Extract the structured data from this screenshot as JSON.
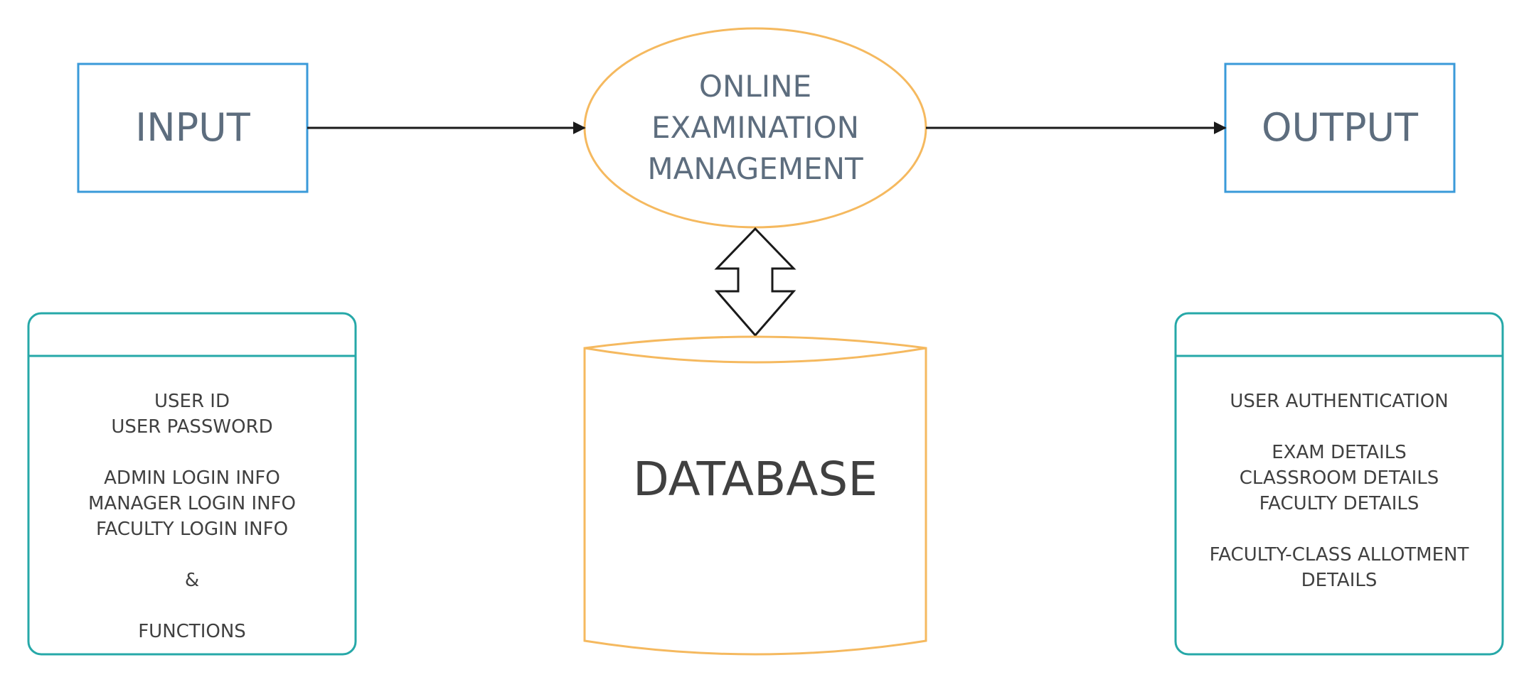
{
  "input_label": "INPUT",
  "output_label": "OUTPUT",
  "process_lines": [
    "ONLINE",
    "EXAMINATION",
    "MANAGEMENT"
  ],
  "database_label": "DATABASE",
  "input_details": {
    "user_id": "USER ID",
    "user_password": "USER PASSWORD",
    "admin_login": "ADMIN LOGIN INFO",
    "manager_login": "MANAGER LOGIN INFO",
    "faculty_login": "FACULTY LOGIN INFO",
    "ampersand": "&",
    "functions": "FUNCTIONS"
  },
  "output_details": {
    "user_auth": "USER AUTHENTICATION",
    "exam_details": "EXAM DETAILS",
    "classroom_details": "CLASSROOM DETAILS",
    "faculty_details": "FACULTY DETAILS",
    "allotment_line1": "FACULTY-CLASS ALLOTMENT",
    "allotment_line2": "DETAILS"
  },
  "colors": {
    "box_stroke": "#3a9ad9",
    "ellipse_stroke": "#f5b95f",
    "list_stroke": "#26a8a8",
    "arrow": "#1a1a1a",
    "text_title": "#5d6d7e",
    "text_body": "#404040"
  }
}
